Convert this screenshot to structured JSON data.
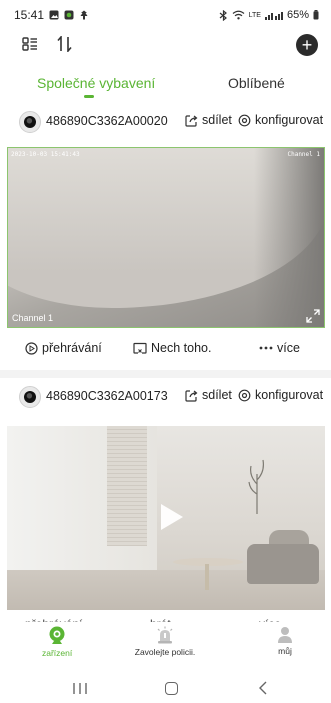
{
  "status_bar": {
    "time": "15:41",
    "battery": "65%",
    "network": "LTE"
  },
  "toolbar": {
    "list_icon": "list-view-icon",
    "sort_icon": "sort-icon",
    "add_icon": "plus-circle-icon",
    "add_symbol": "+"
  },
  "tabs": [
    {
      "label": "Společné vybavení",
      "active": true
    },
    {
      "label": "Oblíbené",
      "active": false
    }
  ],
  "devices": [
    {
      "name": "486890C3362A00020",
      "share_label": "sdílet",
      "config_label": "konfigurovat",
      "osd_time": "2023-10-03 15:41:43",
      "osd_channel": "Channel 1",
      "channel_label": "Channel 1",
      "actions": [
        {
          "label": "přehrávání",
          "icon": "play-circle-icon"
        },
        {
          "label": "Nech toho.",
          "icon": "stop-screen-icon"
        },
        {
          "label": "více",
          "icon": "more-dots-icon"
        }
      ]
    },
    {
      "name": "486890C3362A00173",
      "share_label": "sdílet",
      "config_label": "konfigurovat",
      "partial_actions": [
        {
          "label": "přehrávání"
        },
        {
          "label": "hrát"
        },
        {
          "label": "více"
        }
      ]
    }
  ],
  "bottom_tabs": [
    {
      "label": "zařízení",
      "icon": "camera-icon",
      "active": true
    },
    {
      "label": "Zavolejte policii.",
      "icon": "alarm-siren-icon",
      "active": false
    },
    {
      "label": "můj",
      "icon": "person-icon",
      "active": false
    }
  ],
  "colors": {
    "accent": "#5ab534",
    "text": "#222222",
    "divider": "#f3f3f3"
  }
}
